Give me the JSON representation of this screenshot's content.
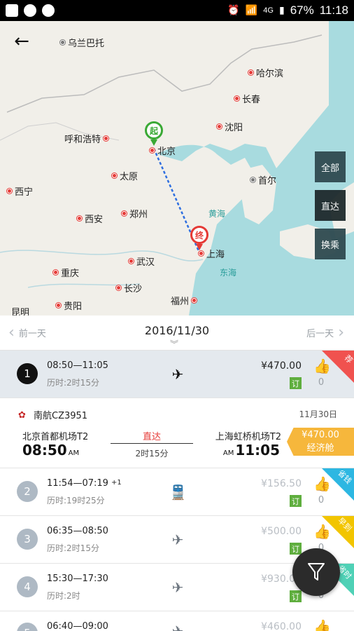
{
  "status_bar": {
    "battery": "67%",
    "clock": "11:18",
    "network": "4G"
  },
  "map": {
    "cities": [
      {
        "name": "乌兰巴托",
        "kind": "grey"
      },
      {
        "name": "哈尔滨"
      },
      {
        "name": "长春"
      },
      {
        "name": "呼和浩特"
      },
      {
        "name": "沈阳"
      },
      {
        "name": "北京"
      },
      {
        "name": "太原"
      },
      {
        "name": "首尔"
      },
      {
        "name": "西宁"
      },
      {
        "name": "西安"
      },
      {
        "name": "郑州"
      },
      {
        "name": "上海"
      },
      {
        "name": "武汉"
      },
      {
        "name": "重庆"
      },
      {
        "name": "长沙"
      },
      {
        "name": "福州"
      },
      {
        "name": "昆明"
      },
      {
        "name": "贵阳"
      }
    ],
    "seas": [
      "黄海",
      "东海"
    ],
    "start_pin": "起",
    "end_pin": "终",
    "filters": [
      "全部",
      "直达",
      "换乘"
    ],
    "active_filter": "直达"
  },
  "date_bar": {
    "prev": "前一天",
    "date": "2016/11/30",
    "next": "后一天"
  },
  "flights": [
    {
      "index": "1",
      "time": "08:50—11:05",
      "time_extra": "",
      "duration": "历时:2时15分",
      "mode": "plane",
      "price": "¥470.00",
      "book": "订",
      "likes": "0",
      "corner": "荐",
      "corner_color": "red"
    },
    {
      "index": "2",
      "time": "11:54—07:19",
      "time_extra": "+1",
      "duration": "历时:19时25分",
      "mode": "train",
      "price": "¥156.50",
      "book": "订",
      "likes": "0",
      "corner": "省钱",
      "corner_color": "blue"
    },
    {
      "index": "3",
      "time": "06:35—08:50",
      "time_extra": "",
      "duration": "历时:2时15分",
      "mode": "plane",
      "price": "¥500.00",
      "book": "订",
      "likes": "0",
      "corner": "早到",
      "corner_color": "yellow"
    },
    {
      "index": "4",
      "time": "15:30—17:30",
      "time_extra": "",
      "duration": "历时:2时",
      "mode": "plane",
      "price": "¥930.00",
      "book": "订",
      "likes": "0",
      "corner": "省时",
      "corner_color": "teal"
    },
    {
      "index": "5",
      "time": "06:40—09:00",
      "time_extra": "",
      "duration": "",
      "mode": "plane",
      "price": "¥460.00",
      "book": "",
      "likes": "",
      "corner": "",
      "corner_color": ""
    }
  ],
  "detail": {
    "airline": "南航CZ3951",
    "date": "11月30日",
    "dep_airport": "北京首都机场T2",
    "dep_time": "08:50",
    "dep_ampm": "AM",
    "arr_airport": "上海虹桥机场T2",
    "arr_time": "11:05",
    "arr_ampm": "AM",
    "type": "直达",
    "duration": "2时15分",
    "price": "¥470.00",
    "cabin": "经济舱"
  },
  "colors": {
    "accent_red": "#e53935",
    "book_green": "#5fae3e",
    "cabin_orange": "#f6b73c",
    "map_water": "#a8dbdf"
  }
}
